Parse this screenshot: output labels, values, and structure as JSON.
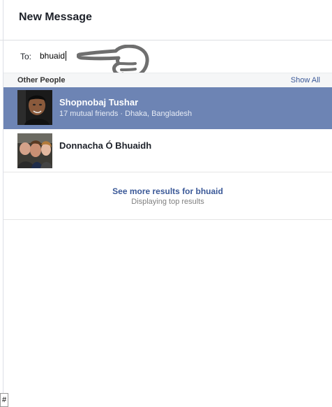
{
  "dialog": {
    "title": "New Message"
  },
  "recipient": {
    "label": "To:",
    "value": "bhuaid"
  },
  "section": {
    "title": "Other People",
    "show_all": "Show All"
  },
  "results": [
    {
      "name": "Shopnobaj Tushar",
      "meta": "17 mutual friends · Dhaka, Bangladesh",
      "selected": true
    },
    {
      "name": "Donnacha Ó Bhuaidh",
      "meta": "",
      "selected": false
    }
  ],
  "more": {
    "link": "See more results for bhuaid",
    "sub": "Displaying top results"
  },
  "footer": {
    "hash": "#"
  },
  "colors": {
    "selected_row": "#6d84b4",
    "link": "#3b5998",
    "section_bg": "#f5f6f7"
  },
  "icons": {
    "pointer": "pointing-hand-icon"
  }
}
